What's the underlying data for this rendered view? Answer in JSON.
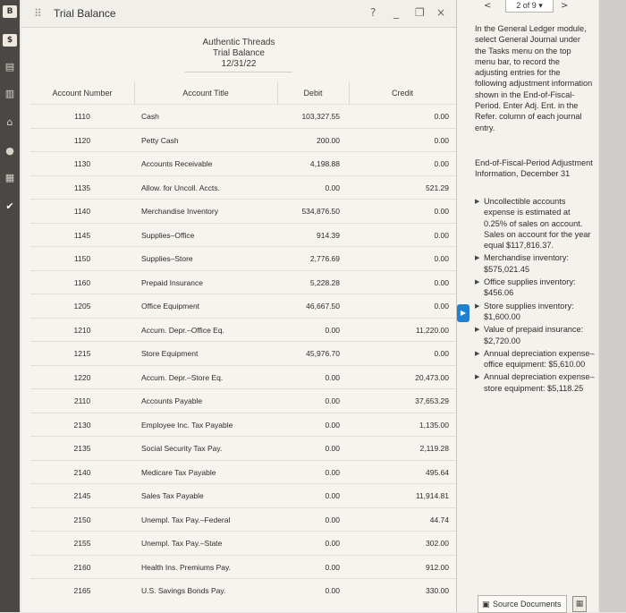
{
  "window": {
    "title": "Trial Balance",
    "help_icon": "?",
    "minimize_icon": "_",
    "restore_icon": "restore",
    "close_icon": "×"
  },
  "report": {
    "company": "Authentic Threads",
    "name": "Trial Balance",
    "date": "12/31/22"
  },
  "columns": {
    "account_number": "Account Number",
    "account_title": "Account Title",
    "debit": "Debit",
    "credit": "Credit"
  },
  "rows": [
    {
      "number": "1110",
      "title": "Cash",
      "debit": "103,327.55",
      "credit": "0.00"
    },
    {
      "number": "1120",
      "title": "Petty Cash",
      "debit": "200.00",
      "credit": "0.00"
    },
    {
      "number": "1130",
      "title": "Accounts Receivable",
      "debit": "4,198.88",
      "credit": "0.00"
    },
    {
      "number": "1135",
      "title": "Allow. for Uncoll. Accts.",
      "debit": "0.00",
      "credit": "521.29"
    },
    {
      "number": "1140",
      "title": "Merchandise Inventory",
      "debit": "534,876.50",
      "credit": "0.00"
    },
    {
      "number": "1145",
      "title": "Supplies–Office",
      "debit": "914.39",
      "credit": "0.00"
    },
    {
      "number": "1150",
      "title": "Supplies–Store",
      "debit": "2,776.69",
      "credit": "0.00"
    },
    {
      "number": "1160",
      "title": "Prepaid Insurance",
      "debit": "5,228.28",
      "credit": "0.00"
    },
    {
      "number": "1205",
      "title": "Office Equipment",
      "debit": "46,667.50",
      "credit": "0.00"
    },
    {
      "number": "1210",
      "title": "Accum. Depr.–Office Eq.",
      "debit": "0.00",
      "credit": "11,220.00"
    },
    {
      "number": "1215",
      "title": "Store Equipment",
      "debit": "45,976.70",
      "credit": "0.00"
    },
    {
      "number": "1220",
      "title": "Accum. Depr.–Store Eq.",
      "debit": "0.00",
      "credit": "20,473.00"
    },
    {
      "number": "2110",
      "title": "Accounts Payable",
      "debit": "0.00",
      "credit": "37,653.29"
    },
    {
      "number": "2130",
      "title": "Employee Inc. Tax Payable",
      "debit": "0.00",
      "credit": "1,135.00"
    },
    {
      "number": "2135",
      "title": "Social Security Tax Pay.",
      "debit": "0.00",
      "credit": "2,119.28"
    },
    {
      "number": "2140",
      "title": "Medicare Tax Payable",
      "debit": "0.00",
      "credit": "495.64"
    },
    {
      "number": "2145",
      "title": "Sales Tax Payable",
      "debit": "0.00",
      "credit": "11,914.81"
    },
    {
      "number": "2150",
      "title": "Unempl. Tax Pay.–Federal",
      "debit": "0.00",
      "credit": "44.74"
    },
    {
      "number": "2155",
      "title": "Unempl. Tax Pay.–State",
      "debit": "0.00",
      "credit": "302.00"
    },
    {
      "number": "2160",
      "title": "Health Ins. Premiums Pay.",
      "debit": "0.00",
      "credit": "912.00"
    },
    {
      "number": "2165",
      "title": "U.S. Savings Bonds Pay.",
      "debit": "0.00",
      "credit": "330.00"
    }
  ],
  "panel": {
    "prev": "<",
    "next": ">",
    "page": "2 of 9",
    "instructions": "In the General Ledger module, select General Journal under the Tasks menu on the top menu bar, to record the adjusting entries for the following adjustment information shown in the End-of-Fiscal-Period. Enter Adj. Ent. in the Refer. column of each journal entry.",
    "info_title": "End-of-Fiscal-Period Adjustment Information, December 31",
    "bullets": [
      "Uncollectible accounts expense is estimated at 0.25% of sales on account. Sales on account for the year equal $117,816.37.",
      "Merchandise inventory: $575,021.45",
      "Office supplies inventory: $456.06",
      "Store supplies inventory: $1,600.00",
      "Value of prepaid insurance: $2,720.00",
      "Annual depreciation expense–office equipment: $5,610.00",
      "Annual depreciation expense–store equipment: $5,118.25"
    ],
    "source_documents": "Source Documents"
  },
  "sidebar_icons": [
    "b-badge-icon",
    "dollar-badge-icon",
    "ledger-icon",
    "chart-icon",
    "bank-icon",
    "payroll-icon",
    "report-icon",
    "check-icon"
  ]
}
